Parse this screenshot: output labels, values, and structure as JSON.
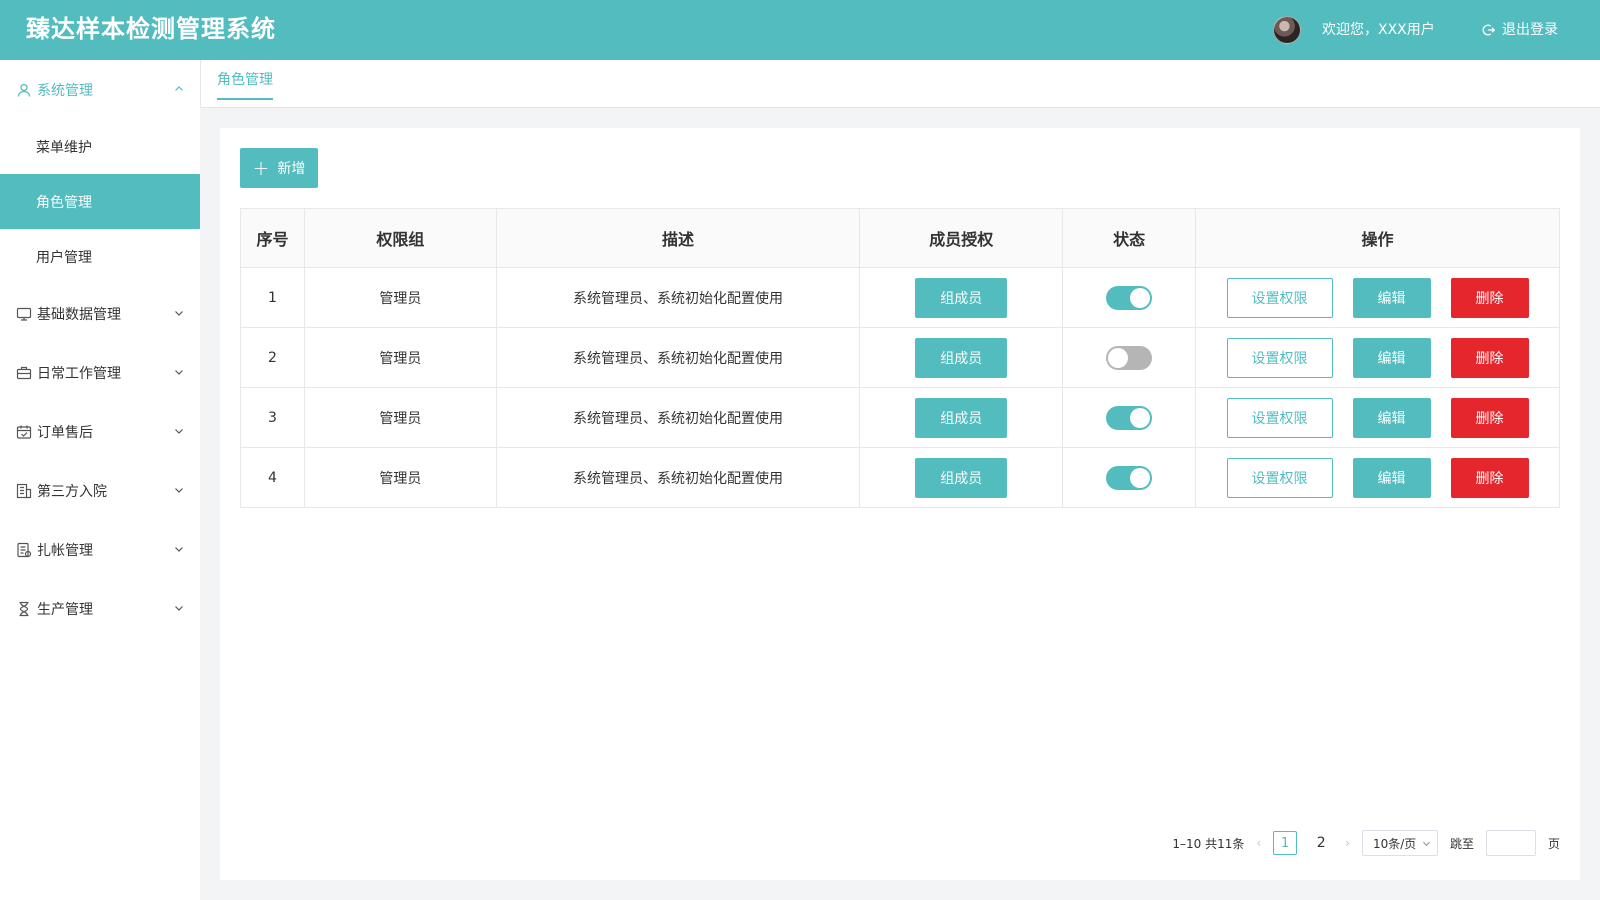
{
  "header": {
    "title": "臻达样本检测管理系统",
    "welcome": "欢迎您，XXX用户",
    "logout": "退出登录"
  },
  "sidebar": {
    "system": {
      "label": "系统管理",
      "icon": "user-icon"
    },
    "sub_items": [
      {
        "label": "菜单维护"
      },
      {
        "label": "角色管理"
      },
      {
        "label": "用户管理"
      }
    ],
    "items": [
      {
        "label": "基础数据管理",
        "icon": "monitor-icon"
      },
      {
        "label": "日常工作管理",
        "icon": "briefcase-icon"
      },
      {
        "label": "订单售后",
        "icon": "calendar-icon"
      },
      {
        "label": "第三方入院",
        "icon": "building-icon"
      },
      {
        "label": "扎帐管理",
        "icon": "ledger-icon"
      },
      {
        "label": "生产管理",
        "icon": "hourglass-icon"
      }
    ]
  },
  "tabs": {
    "active": "角色管理"
  },
  "toolbar": {
    "add_label": "新增"
  },
  "table": {
    "headers": [
      "序号",
      "权限组",
      "描述",
      "成员授权",
      "状态",
      "操作"
    ],
    "rows": [
      {
        "index": "1",
        "group": "管理员",
        "desc": "系统管理员、系统初始化配置使用",
        "enabled": true
      },
      {
        "index": "2",
        "group": "管理员",
        "desc": "系统管理员、系统初始化配置使用",
        "enabled": false
      },
      {
        "index": "3",
        "group": "管理员",
        "desc": "系统管理员、系统初始化配置使用",
        "enabled": true
      },
      {
        "index": "4",
        "group": "管理员",
        "desc": "系统管理员、系统初始化配置使用",
        "enabled": true
      }
    ],
    "member_btn": "组成员",
    "perm_btn": "设置权限",
    "edit_btn": "编辑",
    "delete_btn": "删除"
  },
  "pagination": {
    "summary": "1–10 共11条",
    "pages": [
      "1",
      "2"
    ],
    "current": "1",
    "page_size": "10条/页",
    "jump_label": "跳至",
    "page_suffix": "页"
  },
  "colors": {
    "accent": "#52bcbf",
    "danger": "#e6262d",
    "switch_off": "#b5b5b5"
  }
}
